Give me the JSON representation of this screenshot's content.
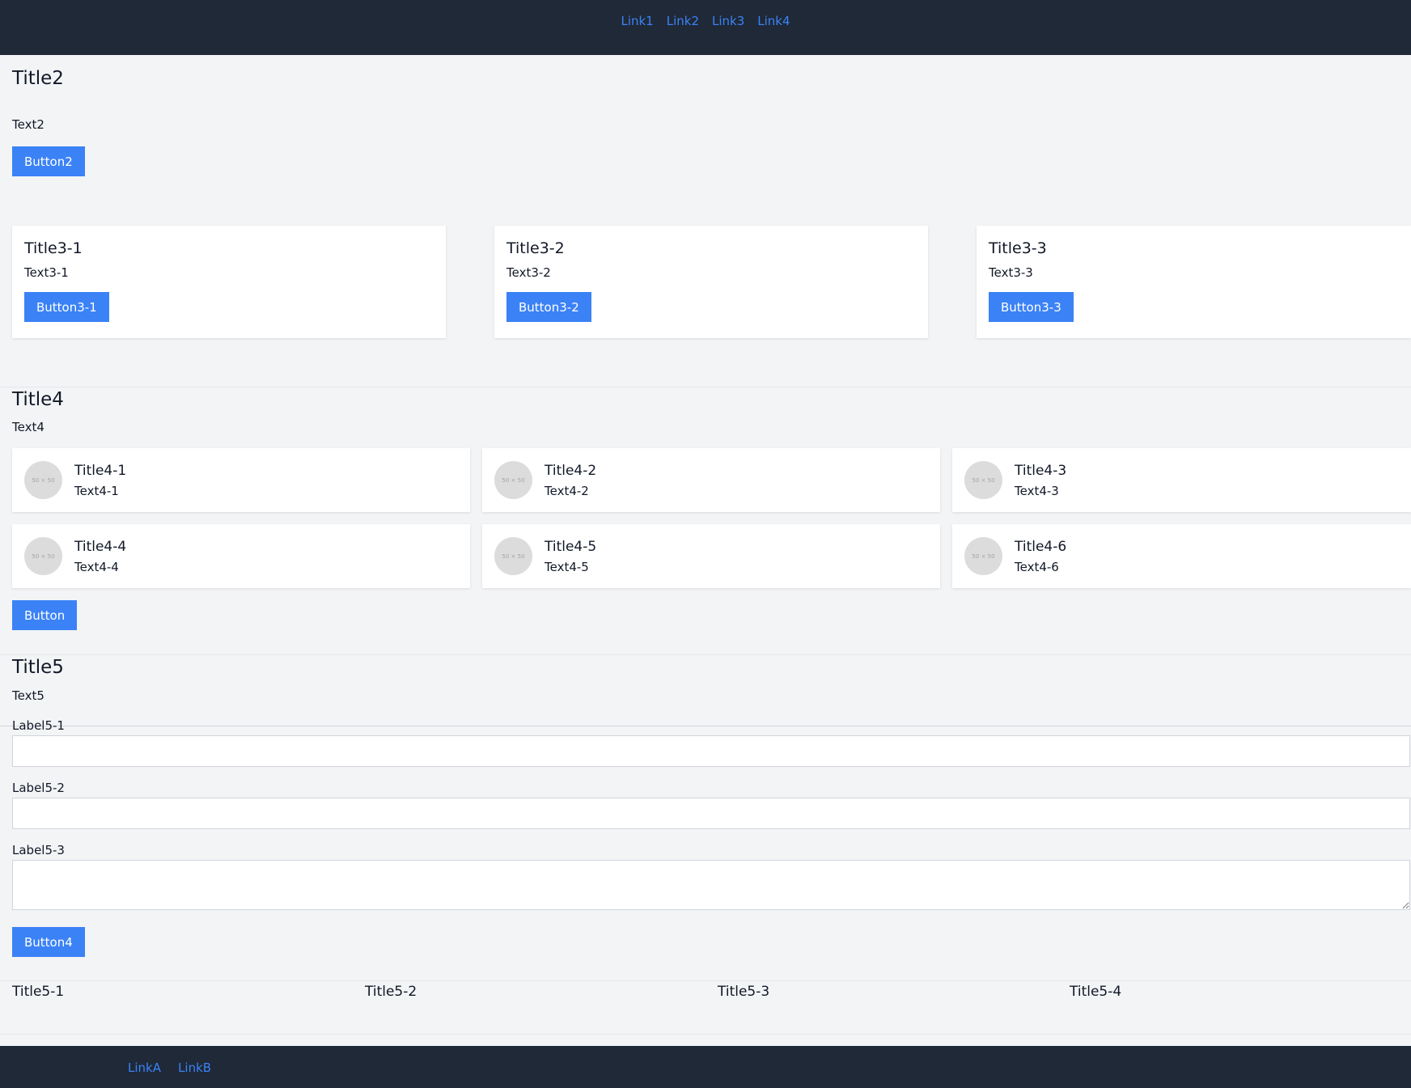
{
  "nav": {
    "links": [
      "Link1",
      "Link2",
      "Link3",
      "Link4"
    ]
  },
  "hero": {
    "title": "Title2",
    "text": "Text2",
    "button": "Button2"
  },
  "cards3": [
    {
      "title": "Title3-1",
      "text": "Text3-1",
      "button": "Button3-1"
    },
    {
      "title": "Title3-2",
      "text": "Text3-2",
      "button": "Button3-2"
    },
    {
      "title": "Title3-3",
      "text": "Text3-3",
      "button": "Button3-3"
    }
  ],
  "section4": {
    "title": "Title4",
    "text": "Text4",
    "avatar_text": "50 × 50",
    "items": [
      {
        "title": "Title4-1",
        "text": "Text4-1"
      },
      {
        "title": "Title4-2",
        "text": "Text4-2"
      },
      {
        "title": "Title4-3",
        "text": "Text4-3"
      },
      {
        "title": "Title4-4",
        "text": "Text4-4"
      },
      {
        "title": "Title4-5",
        "text": "Text4-5"
      },
      {
        "title": "Title4-6",
        "text": "Text4-6"
      }
    ],
    "button": "Button"
  },
  "section5": {
    "title": "Title5",
    "text": "Text5",
    "fields": [
      {
        "label": "Label5-1",
        "value": "",
        "placeholder": ""
      },
      {
        "label": "Label5-2",
        "value": "",
        "placeholder": ""
      },
      {
        "label": "Label5-3",
        "value": "",
        "placeholder": ""
      }
    ],
    "button": "Button4",
    "columns": [
      "Title5-1",
      "Title5-2",
      "Title5-3",
      "Title5-4"
    ]
  },
  "footer": {
    "links": [
      "LinkA",
      "LinkB"
    ]
  },
  "colors": {
    "nav_bg": "#1f2937",
    "accent": "#3b82f6",
    "page_bg": "#f3f4f6"
  }
}
